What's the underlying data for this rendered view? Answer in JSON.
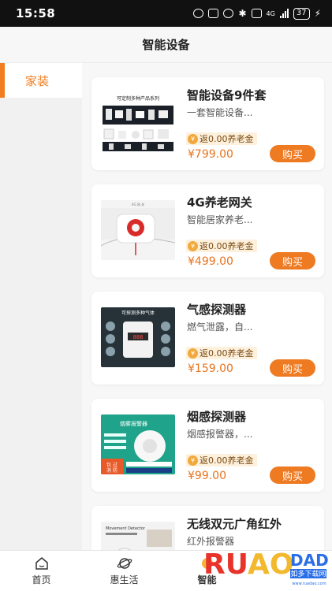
{
  "status_bar": {
    "time": "15:58",
    "battery": "37",
    "network": "4G"
  },
  "header": {
    "title": "智能设备"
  },
  "sidebar": {
    "items": [
      {
        "label": "家装"
      }
    ]
  },
  "products": [
    {
      "name": "智能设备9件套",
      "desc": "一套智能设备...",
      "rebate": "返0.00养老金",
      "price": "¥799.00",
      "buy": "购买",
      "image_caption": "可定制多种产品系列"
    },
    {
      "name": "4G养老网关",
      "desc": "智能居家养老...",
      "rebate": "返0.00养老金",
      "price": "¥499.00",
      "buy": "购买",
      "image_caption": ""
    },
    {
      "name": "气感探测器",
      "desc": "燃气泄露，自...",
      "rebate": "返0.00养老金",
      "price": "¥159.00",
      "buy": "购买",
      "image_caption": "可探测多种气体"
    },
    {
      "name": "烟感探测器",
      "desc": "烟感报警器，...",
      "rebate": "返0.00养老金",
      "price": "¥99.00",
      "buy": "购买",
      "image_caption": "烟雾报警器"
    },
    {
      "name": "无线双元广角红外",
      "desc": "红外报警器",
      "rebate": "",
      "price": "",
      "buy": "",
      "image_caption": "Movement Detector"
    }
  ],
  "bottom_nav": [
    {
      "label": "首页",
      "icon": "home-icon"
    },
    {
      "label": "惠生活",
      "icon": "planet-icon"
    },
    {
      "label": "智能",
      "icon": "smart-icon"
    }
  ],
  "watermark": {
    "brand": "RUAODADO",
    "tagline": "如多下载网",
    "url": "www.ruadao.com"
  },
  "colors": {
    "accent": "#ee7a22",
    "price": "#e8731c",
    "rebate_bg": "#fdf0dd"
  }
}
